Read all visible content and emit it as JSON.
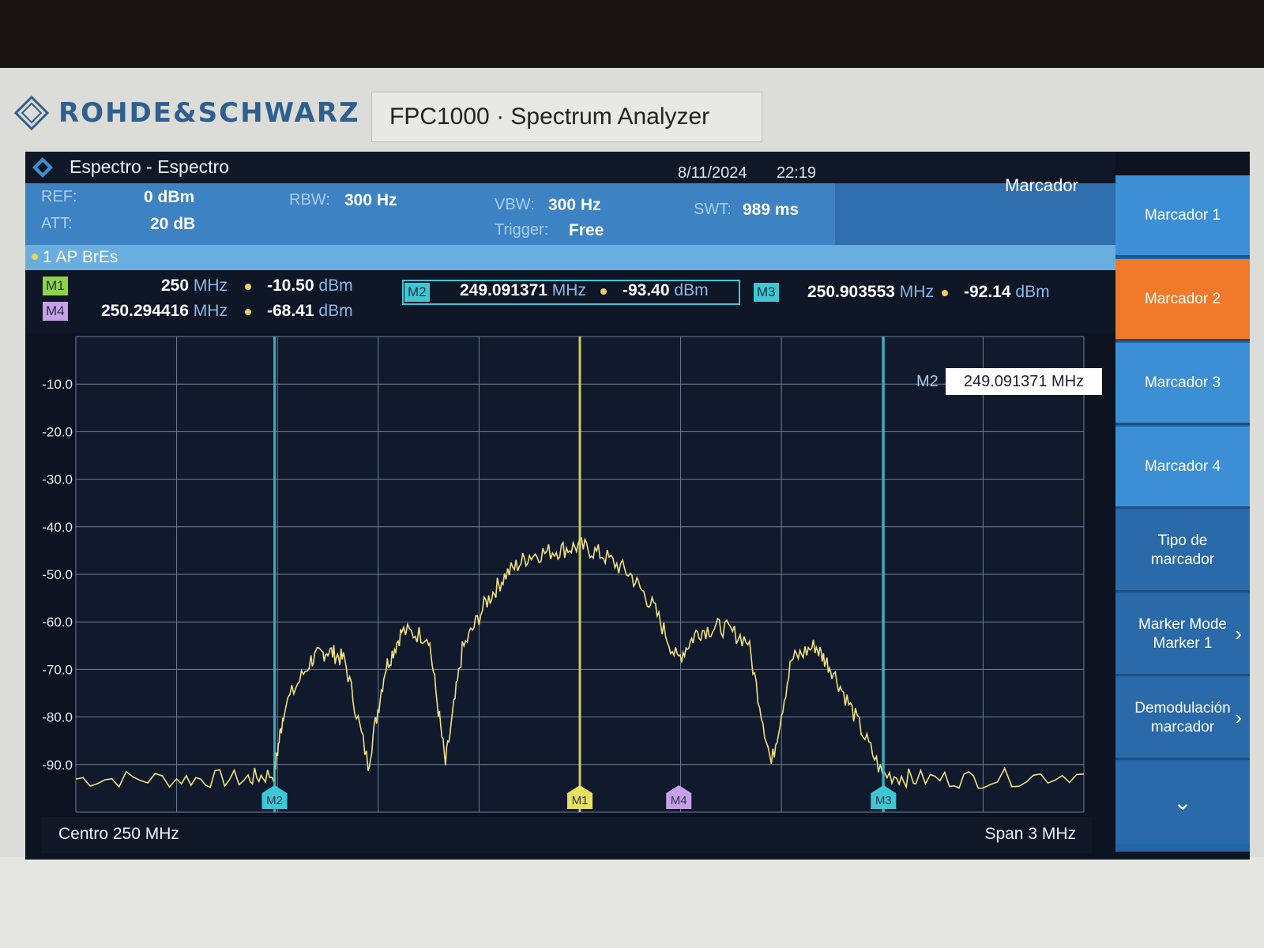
{
  "device": {
    "brand": "ROHDE&SCHWARZ",
    "model": "FPC1000 · Spectrum Analyzer"
  },
  "titlebar": {
    "title": "Espectro - Espectro",
    "date": "8/11/2024",
    "time": "22:19"
  },
  "settings": {
    "ref_label": "REF:",
    "ref_value": "0 dBm",
    "att_label": "ATT:",
    "att_value": "20 dB",
    "rbw_label": "RBW:",
    "rbw_value": "300 Hz",
    "vbw_label": "VBW:",
    "vbw_value": "300 Hz",
    "trigger_label": "Trigger:",
    "trigger_value": "Free",
    "swt_label": "SWT:",
    "swt_value": "989 ms"
  },
  "marker_panel": {
    "title": "Marcador",
    "edit_label": "M2",
    "edit_value": "249.091371 MHz"
  },
  "trace": {
    "label": "1 AP  BrEs"
  },
  "markers": [
    {
      "id": "M1",
      "freq": "250",
      "freq_unit": "MHz",
      "level": "-10.50",
      "level_unit": "dBm",
      "color": "#8fd24a"
    },
    {
      "id": "M2",
      "freq": "249.091371",
      "freq_unit": "MHz",
      "level": "-93.40",
      "level_unit": "dBm",
      "color": "#3ec7d4"
    },
    {
      "id": "M3",
      "freq": "250.903553",
      "freq_unit": "MHz",
      "level": "-92.14",
      "level_unit": "dBm",
      "color": "#3ec7d4"
    },
    {
      "id": "M4",
      "freq": "250.294416",
      "freq_unit": "MHz",
      "level": "-68.41",
      "level_unit": "dBm",
      "color": "#c8a0e8"
    }
  ],
  "footer": {
    "center": "Centro 250 MHz",
    "span": "Span 3 MHz"
  },
  "softkeys": [
    {
      "label1": "Marcador 1",
      "label2": ""
    },
    {
      "label1": "Marcador 2",
      "label2": ""
    },
    {
      "label1": "Marcador 3",
      "label2": ""
    },
    {
      "label1": "Marcador 4",
      "label2": ""
    },
    {
      "label1": "Tipo de",
      "label2": "marcador"
    },
    {
      "label1": "Marker Mode",
      "label2": "Marker 1"
    },
    {
      "label1": "Demodulación",
      "label2": "marcador"
    }
  ],
  "chart_data": {
    "type": "line",
    "title": "",
    "xlabel": "",
    "ylabel": "",
    "ylim": [
      -100,
      0
    ],
    "y_ticks": [
      "-10.0",
      "-20.0",
      "-30.0",
      "-40.0",
      "-50.0",
      "-60.0",
      "-70.0",
      "-80.0",
      "-90.0"
    ],
    "xlim_mhz": [
      248.5,
      251.5
    ],
    "grid": true,
    "series": [
      {
        "x": [
          248.5,
          248.8,
          249.0,
          249.09,
          249.12,
          249.2,
          249.25,
          249.3,
          249.37,
          249.42,
          249.47,
          249.55,
          249.6,
          249.65,
          249.72,
          249.78,
          249.85,
          249.93,
          250.0,
          250.07,
          250.15,
          250.22,
          250.29,
          250.35,
          250.42,
          250.5,
          250.57,
          250.63,
          250.7,
          250.75,
          250.82,
          250.9,
          251.0,
          251.2,
          251.5
        ],
        "y": [
          -93,
          -93,
          -93,
          -92,
          -78,
          -68,
          -66,
          -68,
          -90,
          -70,
          -62,
          -63,
          -90,
          -66,
          -56,
          -50,
          -46,
          -45,
          -44,
          -46,
          -50,
          -57,
          -68,
          -62,
          -61,
          -64,
          -90,
          -68,
          -65,
          -70,
          -80,
          -92,
          -93,
          -93,
          -92
        ]
      }
    ],
    "marker_positions_mhz": {
      "M1": 250.0,
      "M2": 249.091371,
      "M3": 250.903553,
      "M4": 250.294416
    }
  }
}
